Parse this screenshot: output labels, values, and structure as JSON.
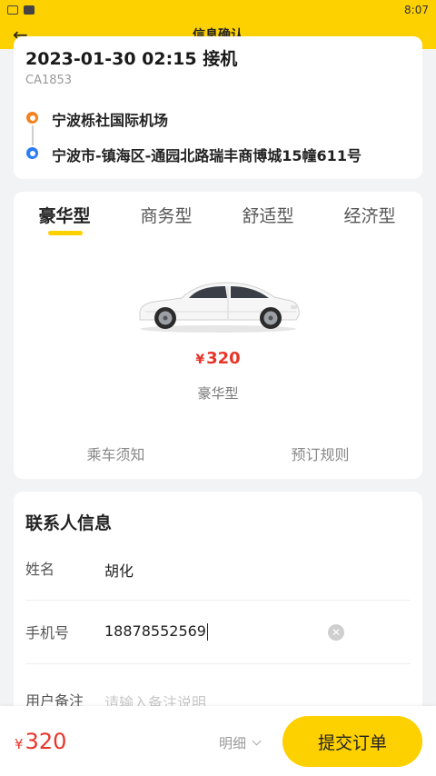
{
  "status": {
    "time": "8:07"
  },
  "header": {
    "title": "信息确认",
    "back_icon": "arrow-left-icon"
  },
  "trip": {
    "datetime": "2023-01-30 02:15 接机",
    "flight_no": "CA1853",
    "from": "宁波栎社国际机场",
    "to": "宁波市-镇海区-通园北路瑞丰商博城15幢611号"
  },
  "cars": {
    "tabs": [
      "豪华型",
      "商务型",
      "舒适型",
      "经济型"
    ],
    "selected_tab": "豪华型",
    "currency": "¥",
    "price": "320",
    "selected_type": "豪华型",
    "links": [
      "乘车须知",
      "预订规则"
    ]
  },
  "contact": {
    "title": "联系人信息",
    "name_label": "姓名",
    "name_value": "胡化",
    "phone_label": "手机号",
    "phone_value": "18878552569",
    "remark_label": "用户备注",
    "remark_placeholder": "请输入备注说明"
  },
  "footer": {
    "currency": "¥",
    "total": "320",
    "detail_label": "明细",
    "submit_label": "提交订单"
  },
  "colors": {
    "accent": "#fdd000",
    "price": "#e8352a",
    "origin_dot": "#f5811f",
    "dest_dot": "#2b7cf6"
  }
}
